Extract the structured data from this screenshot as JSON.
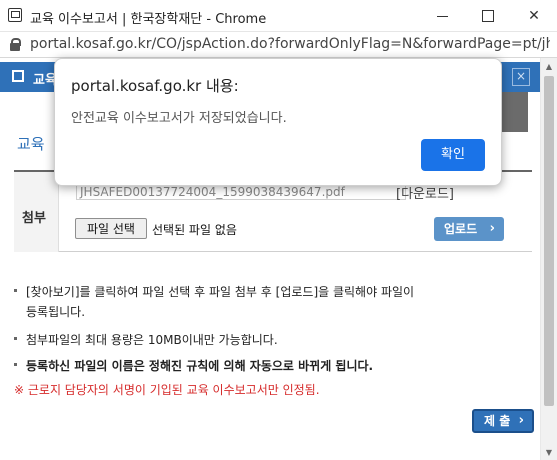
{
  "window": {
    "title": "교육 이수보고서 | 한국장학재단 - Chrome",
    "url": "portal.kosaf.go.kr/CO/jspAction.do?forwardOnlyFlag=N&forwardPage=pt/jh/l..."
  },
  "popup": {
    "title": "교육",
    "close_glyph": "×"
  },
  "section": {
    "title": "교육"
  },
  "form": {
    "attach_label": "첨부",
    "filename": "JHSAFED00137724004_1599038439647.pdf",
    "download_label": "[다운로드]",
    "file_select_label": "파일 선택",
    "no_file_text": "선택된 파일 없음",
    "upload_label": "업로드"
  },
  "notes": [
    "[찾아보기]를 클릭하여 파일 선택 후 파일 첨부 후 [업로드]을 클릭해야 파일이",
    "등록됩니다.",
    "첨부파일의 최대 용량은 10MB이내만 가능합니다.",
    "등록하신 파일의 이름은 정해진 규칙에 의해 자동으로 바뀌게 됩니다."
  ],
  "warning": "※ 근로지 담당자의 서명이 기입된 교육 이수보고서만 인정됨.",
  "submit_label": "제 출",
  "dialog": {
    "title": "portal.kosaf.go.kr 내용:",
    "message": "안전교육 이수보고서가 저장되었습니다.",
    "ok_label": "확인"
  },
  "colors": {
    "brand_blue": "#2f71b8",
    "chrome_button_blue": "#1a73e8",
    "warning_red": "#d62b2b"
  },
  "icons": {
    "window_icon": "app-window-icon",
    "lock": "lock-icon",
    "minimize": "minimize-icon",
    "maximize": "maximize-icon",
    "close": "close-icon"
  }
}
